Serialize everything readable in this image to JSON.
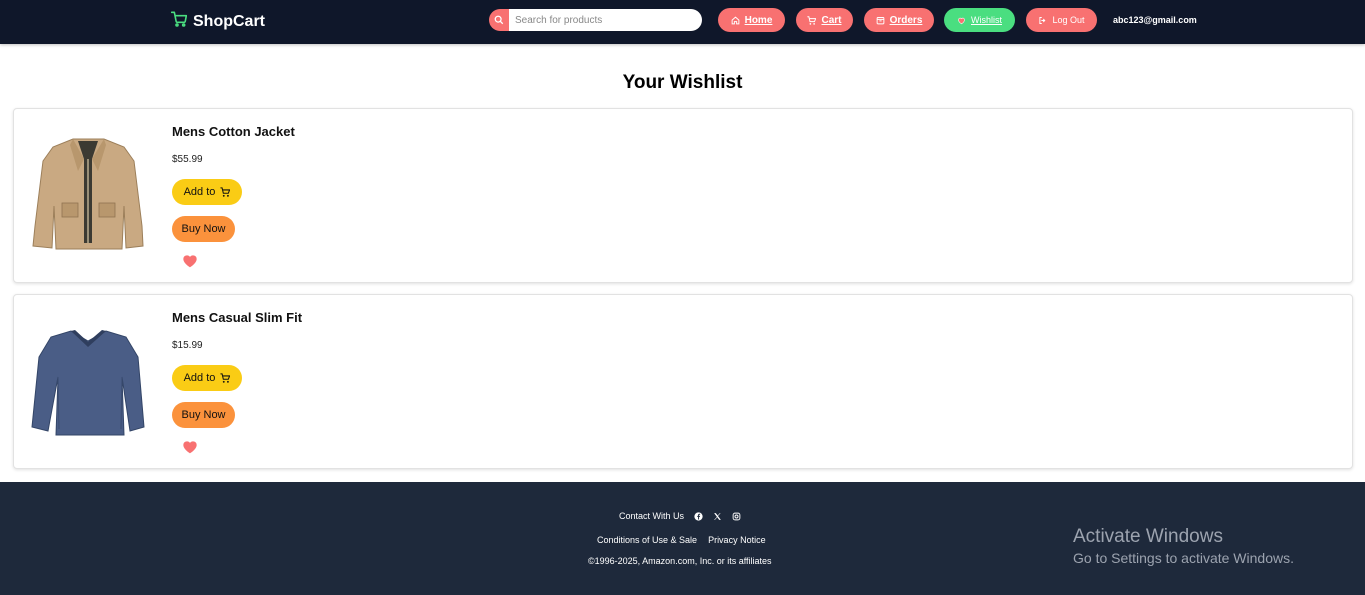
{
  "header": {
    "brand": "ShopCart",
    "search_placeholder": "Search for products",
    "nav": {
      "home": "Home",
      "cart": "Cart",
      "orders": "Orders",
      "wishlist": "Wishlist",
      "logout": "Log Out"
    },
    "user_email": "abc123@gmail.com"
  },
  "main": {
    "title": "Your Wishlist",
    "items": [
      {
        "name": "Mens Cotton Jacket",
        "price": "$55.99",
        "add_label": "Add to",
        "buy_label": "Buy Now"
      },
      {
        "name": "Mens Casual Slim Fit",
        "price": "$15.99",
        "add_label": "Add to",
        "buy_label": "Buy Now"
      }
    ]
  },
  "footer": {
    "contact": "Contact With Us",
    "conditions": "Conditions of Use & Sale",
    "privacy": "Privacy Notice",
    "copyright": "©1996-2025, Amazon.com, Inc. or its affiliates"
  },
  "watermark": {
    "line1": "Activate Windows",
    "line2": "Go to Settings to activate Windows."
  },
  "colors": {
    "header_bg": "#0f172a",
    "footer_bg": "#1e293b",
    "nav_red": "#f87171",
    "nav_green": "#4ade80",
    "add_yellow": "#facc15",
    "buy_orange": "#fb923c",
    "heart": "#f87171"
  }
}
